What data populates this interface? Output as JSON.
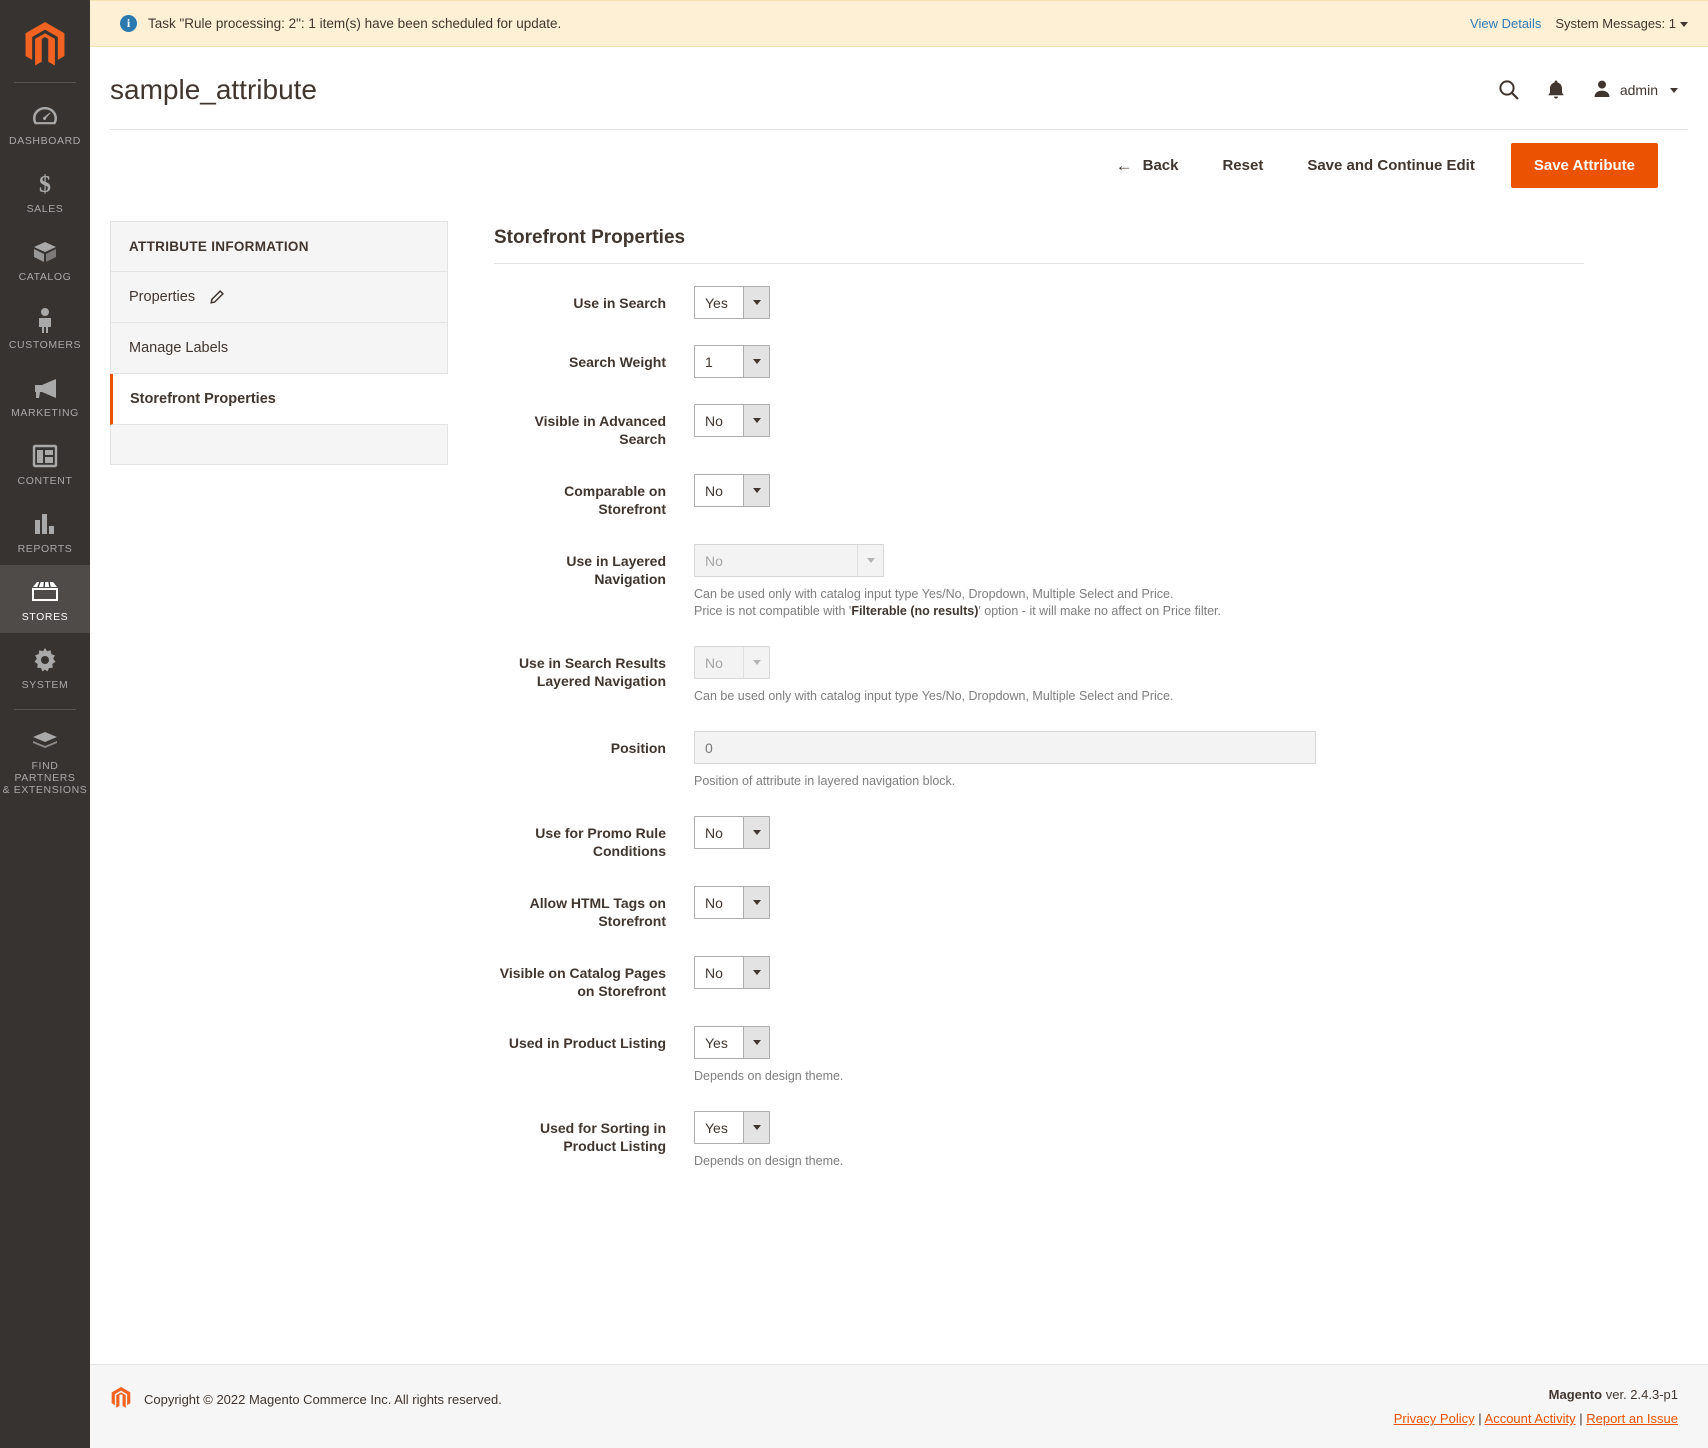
{
  "sidebar": {
    "logo_name": "magento-logo-icon",
    "items": [
      {
        "label": "DASHBOARD",
        "icon": "dashboard-icon",
        "active": false
      },
      {
        "label": "SALES",
        "icon": "dollar-icon",
        "active": false
      },
      {
        "label": "CATALOG",
        "icon": "box-icon",
        "active": false
      },
      {
        "label": "CUSTOMERS",
        "icon": "person-icon",
        "active": false
      },
      {
        "label": "MARKETING",
        "icon": "megaphone-icon",
        "active": false
      },
      {
        "label": "CONTENT",
        "icon": "layout-icon",
        "active": false
      },
      {
        "label": "REPORTS",
        "icon": "bar-chart-icon",
        "active": false
      },
      {
        "label": "STORES",
        "icon": "storefront-icon",
        "active": true
      },
      {
        "label": "SYSTEM",
        "icon": "gear-icon",
        "active": false
      },
      {
        "label": "FIND PARTNERS\n& EXTENSIONS",
        "label_line1": "FIND PARTNERS",
        "label_line2": "& EXTENSIONS",
        "icon": "extensions-icon",
        "active": false
      }
    ]
  },
  "system_message": {
    "text": "Task \"Rule processing: 2\": 1 item(s) have been scheduled for update.",
    "view_details": "View Details",
    "counter_label": "System Messages: 1"
  },
  "header": {
    "title": "sample_attribute",
    "search_icon": "search-icon",
    "notifications_icon": "bell-icon",
    "user": "admin"
  },
  "toolbar": {
    "back": "Back",
    "reset": "Reset",
    "save_continue": "Save and Continue Edit",
    "save": "Save Attribute",
    "primary_color": "#eb5202"
  },
  "tabs": {
    "heading": "ATTRIBUTE INFORMATION",
    "items": [
      {
        "label": "Properties",
        "has_pencil": true,
        "active": false
      },
      {
        "label": "Manage Labels",
        "has_pencil": false,
        "active": false
      },
      {
        "label": "Storefront Properties",
        "has_pencil": false,
        "active": true
      }
    ]
  },
  "form": {
    "section_title": "Storefront Properties",
    "fields": [
      {
        "label": "Use in Search",
        "type": "select",
        "value": "Yes",
        "disabled": false,
        "note": null
      },
      {
        "label": "Search Weight",
        "type": "select",
        "value": "1",
        "disabled": false,
        "note": null
      },
      {
        "label": "Visible in Advanced Search",
        "label_l1": "Visible in Advanced",
        "label_l2": "Search",
        "type": "select",
        "value": "No",
        "disabled": false,
        "note": null
      },
      {
        "label": "Comparable on Storefront",
        "label_l1": "Comparable on",
        "label_l2": "Storefront",
        "type": "select",
        "value": "No",
        "disabled": false,
        "note": null
      },
      {
        "label": "Use in Layered Navigation",
        "label_l1": "Use in Layered",
        "label_l2": "Navigation",
        "type": "select-wide",
        "value": "No",
        "disabled": true,
        "note_line1": "Can be used only with catalog input type Yes/No, Dropdown, Multiple Select and Price.",
        "note_line2_pre": "Price is not compatible with '",
        "note_line2_bold": "Filterable (no results)",
        "note_line2_post": "' option - it will make no affect on Price filter."
      },
      {
        "label": "Use in Search Results Layered Navigation",
        "label_l1": "Use in Search Results",
        "label_l2": "Layered Navigation",
        "type": "select",
        "value": "No",
        "disabled": true,
        "note": "Can be used only with catalog input type Yes/No, Dropdown, Multiple Select and Price."
      },
      {
        "label": "Position",
        "type": "text",
        "value": "",
        "placeholder": "0",
        "disabled": true,
        "note": "Position of attribute in layered navigation block."
      },
      {
        "label": "Use for Promo Rule Conditions",
        "label_l1": "Use for Promo Rule",
        "label_l2": "Conditions",
        "type": "select",
        "value": "No",
        "disabled": false,
        "note": null
      },
      {
        "label": "Allow HTML Tags on Storefront",
        "label_l1": "Allow HTML Tags on",
        "label_l2": "Storefront",
        "type": "select",
        "value": "No",
        "disabled": false,
        "note": null
      },
      {
        "label": "Visible on Catalog Pages on Storefront",
        "label_l1": "Visible on Catalog Pages",
        "label_l2": "on Storefront",
        "type": "select",
        "value": "No",
        "disabled": false,
        "note": null
      },
      {
        "label": "Used in Product Listing",
        "type": "select",
        "value": "Yes",
        "disabled": false,
        "note": "Depends on design theme."
      },
      {
        "label": "Used for Sorting in Product Listing",
        "label_l1": "Used for Sorting in",
        "label_l2": "Product Listing",
        "type": "select",
        "value": "Yes",
        "disabled": false,
        "note": "Depends on design theme."
      }
    ]
  },
  "footer": {
    "copyright": "Copyright © 2022 Magento Commerce Inc. All rights reserved.",
    "brand": "Magento",
    "version": "ver. 2.4.3-p1",
    "links": [
      "Privacy Policy",
      "Account Activity",
      "Report an Issue"
    ]
  }
}
